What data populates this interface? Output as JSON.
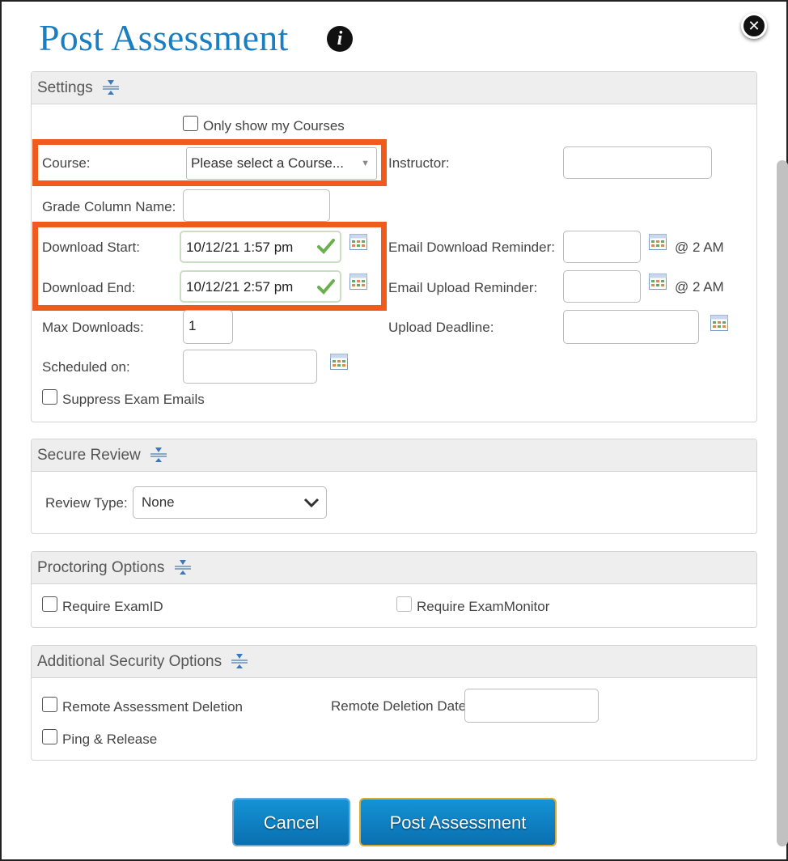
{
  "dialog": {
    "title": "Post Assessment"
  },
  "settings": {
    "header": "Settings",
    "only_my_courses_label": "Only show my Courses",
    "course_label": "Course:",
    "course_value": "Please select a Course...",
    "instructor_label": "Instructor:",
    "instructor_value": "",
    "grade_column_label": "Grade Column Name:",
    "grade_column_value": "",
    "download_start_label": "Download Start:",
    "download_start_value": "10/12/21 1:57 pm",
    "download_end_label": "Download End:",
    "download_end_value": "10/12/21 2:57 pm",
    "email_download_label": "Email Download Reminder:",
    "email_download_value": "",
    "email_download_time": "@ 2 AM",
    "email_upload_label": "Email Upload Reminder:",
    "email_upload_value": "",
    "email_upload_time": "@ 2 AM",
    "max_downloads_label": "Max Downloads:",
    "max_downloads_value": "1",
    "upload_deadline_label": "Upload Deadline:",
    "upload_deadline_value": "",
    "scheduled_on_label": "Scheduled on:",
    "scheduled_on_value": "",
    "suppress_emails_label": "Suppress Exam Emails"
  },
  "secure_review": {
    "header": "Secure Review",
    "review_type_label": "Review Type:",
    "review_type_value": "None"
  },
  "proctoring": {
    "header": "Proctoring Options",
    "require_examid_label": "Require ExamID",
    "require_exammonitor_label": "Require ExamMonitor"
  },
  "additional_security": {
    "header": "Additional Security Options",
    "remote_deletion_label": "Remote Assessment Deletion",
    "remote_deletion_date_label": "Remote Deletion Date:",
    "remote_deletion_date_value": "",
    "ping_release_label": "Ping & Release"
  },
  "buttons": {
    "cancel": "Cancel",
    "post": "Post Assessment"
  },
  "colors": {
    "title": "#1a7fc1",
    "highlight": "#f15a1d",
    "button": "#0a7fc4",
    "button_primary_border": "#e1a82b"
  }
}
